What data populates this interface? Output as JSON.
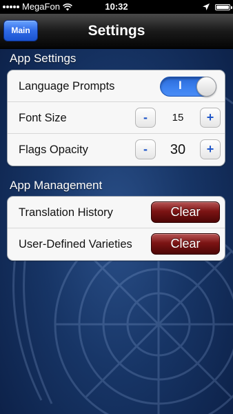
{
  "status_bar": {
    "carrier": "MegaFon",
    "time": "10:32",
    "signal_icon": "signal-dots",
    "wifi_icon": "wifi",
    "location_icon": "location-arrow",
    "battery_icon": "battery-full"
  },
  "nav": {
    "back_label": "Main",
    "title": "Settings"
  },
  "app_settings": {
    "header": "App Settings",
    "language_prompts": {
      "label": "Language Prompts",
      "toggle_on_label": "I",
      "enabled": true
    },
    "font_size": {
      "label": "Font Size",
      "minus": "-",
      "value": "15",
      "plus": "+"
    },
    "flags_opacity": {
      "label": "Flags Opacity",
      "minus": "-",
      "value": "30",
      "plus": "+"
    }
  },
  "app_management": {
    "header": "App Management",
    "translation_history": {
      "label": "Translation History",
      "button": "Clear"
    },
    "user_defined_varieties": {
      "label": "User-Defined Varieties",
      "button": "Clear"
    }
  },
  "colors": {
    "background": "#173566",
    "nav_bar": "#1a1a1a",
    "back_button": "#2f6ae6",
    "toggle_on": "#3d82f0",
    "stepper_text": "#1f56c8",
    "clear_button": "#7c1414"
  }
}
